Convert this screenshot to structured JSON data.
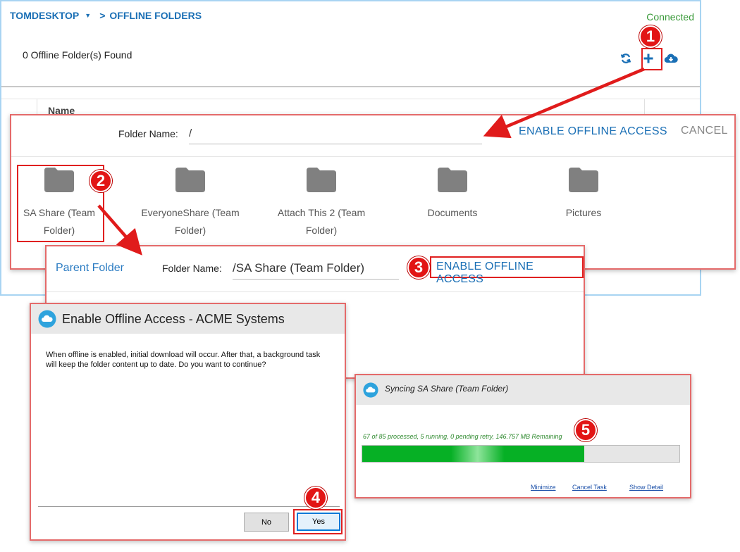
{
  "main": {
    "breadcrumb": {
      "device": "TOMDESKTOP",
      "separator": ">",
      "section": "OFFLINE FOLDERS"
    },
    "connection_status": "Connected",
    "folders_found": "0 Offline Folder(s) Found",
    "table": {
      "column_name": "Name"
    },
    "icons": [
      "refresh-icon",
      "plus-icon",
      "cloud-download-icon"
    ]
  },
  "browse_panel": {
    "folder_name_label": "Folder Name:",
    "folder_name_value": "/",
    "enable_label": "ENABLE OFFLINE ACCESS",
    "cancel_label": "CANCEL",
    "folders": [
      {
        "line1": "SA Share (Team",
        "line2": "Folder)"
      },
      {
        "line1": "EveryoneShare (Team",
        "line2": "Folder)"
      },
      {
        "line1": "Attach This 2 (Team",
        "line2": "Folder)"
      },
      {
        "line1": "Documents",
        "line2": ""
      },
      {
        "line1": "Pictures",
        "line2": ""
      }
    ]
  },
  "parent_panel": {
    "parent_link": "Parent Folder",
    "folder_name_label": "Folder Name:",
    "folder_name_value": "/SA Share (Team Folder)",
    "enable_label": "ENABLE OFFLINE ACCESS"
  },
  "dialog": {
    "title": "Enable Offline Access - ACME Systems",
    "message": "When offline is enabled, initial download will occur. After that, a background task will keep the folder content up to date. Do you want to continue?",
    "no_label": "No",
    "yes_label": "Yes"
  },
  "sync": {
    "title": "Syncing SA Share (Team Folder)",
    "status": "67 of 85 processed, 5 running, 0 pending retry, 146.757 MB Remaining",
    "progress_percent": 70,
    "minimize_label": "Minimize",
    "cancel_label": "Cancel Task",
    "detail_label": "Show Detail"
  },
  "badges": [
    "1",
    "2",
    "3",
    "4",
    "5"
  ],
  "colors": {
    "accent": "#1a6fb5",
    "highlight": "#e02020",
    "connected": "#3a9a3a",
    "progress": "#06b025"
  }
}
